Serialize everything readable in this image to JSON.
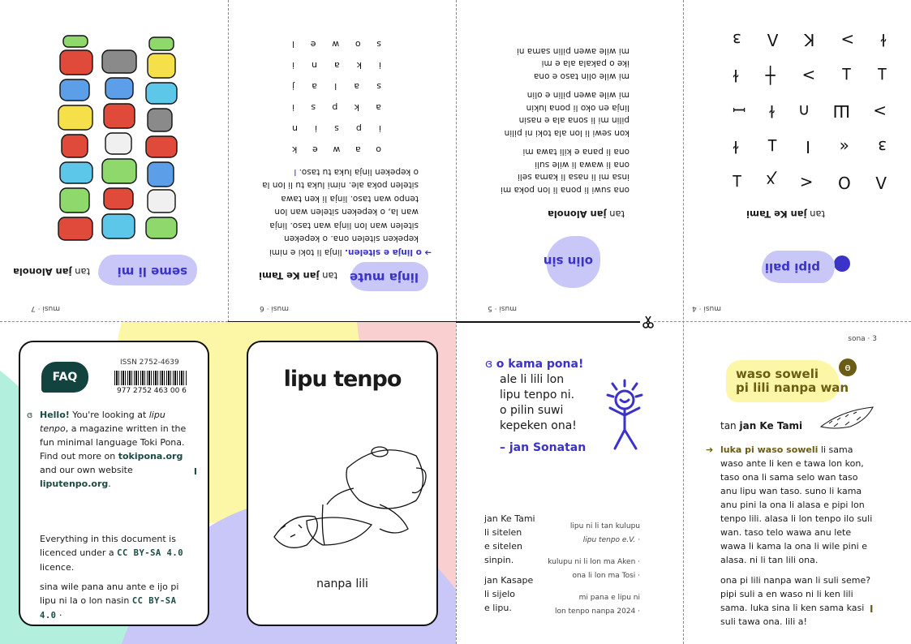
{
  "top": {
    "panel_left": {
      "page_num": "musi · 7",
      "title": "seme li mi",
      "byline_prefix": "tan",
      "byline_author": "jan Alonola"
    },
    "panel_midleft": {
      "page_num": "musi · 6",
      "title": "linja mute",
      "byline_prefix": "tan",
      "byline_author": "jan Ke Tami",
      "lead": "o linja e sitelen.",
      "lines": [
        "linja li toki e nimi",
        "kepeken sitelen ona. o kepeken",
        "sitelen wan lon linja wan taso. linja",
        "wan la, o kepeken sitelen wan lon",
        "tenpo wan taso. linja li ken tawa",
        "sitelen poka ale. nimi luka tu li lon la",
        "o kepeken linja luka tu taso."
      ],
      "grid": [
        [
          "o",
          "a",
          "w",
          "e",
          "k"
        ],
        [
          "i",
          "p",
          "s",
          "i",
          "n"
        ],
        [
          "a",
          "k",
          "p",
          "s",
          "i"
        ],
        [
          "s",
          "a",
          "l",
          "a",
          "j"
        ],
        [
          "i",
          "k",
          "a",
          "n",
          "i"
        ],
        [
          "s",
          "o",
          "w",
          "e",
          "l"
        ]
      ]
    },
    "panel_midright": {
      "page_num": "musi · 5",
      "title": "olin sin",
      "byline_prefix": "tan",
      "byline_author": "jan Alonola",
      "lines": [
        "ona suwi li pona li lon poka mi",
        "insa mi li nasa li kama seli",
        "ona li wawa li wile suli",
        "ona li pana e kili tawa mi",
        "",
        "kon sewi li lon ala toki ni pilin",
        "pilin mi li sona ala e nasin",
        "linja en oko li pona lukin",
        "mi wile awen pilin e olin",
        "",
        "mi wile olin taso e ona",
        "ike o pakala ala e mi",
        "mi wile awen pilin sama ni"
      ]
    },
    "panel_right": {
      "page_num": "musi · 4",
      "title": "pipi pali",
      "byline_prefix": "tan",
      "byline_author": "jan Ke Tami",
      "glyph_rows": [
        [
          "Λ",
          "O",
          "<",
          "ꭗ",
          "Ʇ"
        ],
        [
          "ɜ",
          "«",
          "I",
          "Ʇ",
          "ɫ"
        ],
        [
          ">",
          "Ш",
          "∩",
          "ɫ",
          "ꟷ"
        ],
        [
          "Ʇ",
          "Ʇ",
          ">",
          "┼",
          "ɫ"
        ],
        [
          "ɫ",
          ">",
          "K",
          "Λ",
          "ɜ"
        ]
      ]
    }
  },
  "back_cover": {
    "faq_label": "FAQ",
    "issn": "ISSN 2752-4639",
    "barcode_number": "977 2752 463 00 6",
    "hello": "Hello!",
    "intro_1": " You're looking at ",
    "intro_italic": "lipu tenpo",
    "intro_2": ", a magazine written in the fun minimal language Toki Pona. Find out more on ",
    "link_tokipona": "tokipona.org",
    "intro_3": " and our own website ",
    "link_site": "liputenpo.org",
    "intro_4": ".",
    "licence_1": "Everything in this document is licenced under a ",
    "licence_cc": "CC BY-SA 4.0",
    "licence_2": " licence.",
    "tp_licence_1": "sina wile pana anu ante e ijo pi lipu ni la o lon nasin ",
    "tp_licence_cc": "CC BY-SA 4.0",
    "tp_licence_2": " ·"
  },
  "front_cover": {
    "title": "lipu tenpo",
    "issue": "nanpa lili"
  },
  "inside_credits": {
    "heading": "o kama pona!",
    "welcome_lines": [
      "ale li lili lon",
      "lipu tenpo ni.",
      "o pilin suwi",
      "kepeken ona!"
    ],
    "signoff": "– jan Sonatan",
    "credit_left_1": [
      "jan Ke Tami",
      "li sitelen",
      "e sitelen",
      "sinpin."
    ],
    "credit_left_2": [
      "jan Kasape",
      "li sijelo",
      "e lipu."
    ],
    "credit_right_1": [
      "lipu ni li tan kulupu",
      "lipu tenpo e.V. ·"
    ],
    "credit_right_2": [
      "kulupu ni li lon ma Aken ·",
      "ona li lon ma Tosi ·"
    ],
    "credit_right_3": [
      "mi pana e lipu ni",
      "lon tenpo nanpa 2024 ·"
    ]
  },
  "article": {
    "page_num": "sona · 3",
    "title_line1": "waso soweli",
    "title_line2": "pi lili nanpa wan",
    "byline_prefix": "tan ",
    "byline_author": "jan Ke Tami",
    "lead": "luka pi waso soweli",
    "para1": " li sama waso ante li ken e tawa lon kon, taso ona li sama selo wan taso anu lipu wan taso. suno li kama anu pini la ona li alasa e pipi lon tenpo lili. alasa li lon tenpo ilo suli wan. taso telo wawa anu lete wawa li kama la ona li wile pini e alasa. ni li tan lili ona.",
    "para2": "ona pi lili nanpa wan li suli seme? pipi suli a en waso ni li ken lili sama. luka sina li ken sama kasi suli tawa ona. lili a!"
  },
  "colors": {
    "blue_accent": "#3b33c9",
    "lavender": "#c9c7f7",
    "teal": "#13433f",
    "yellow": "#fbf7a6",
    "mint": "#b2efdc",
    "pink": "#f9cfcf",
    "olive": "#6b5d14"
  }
}
